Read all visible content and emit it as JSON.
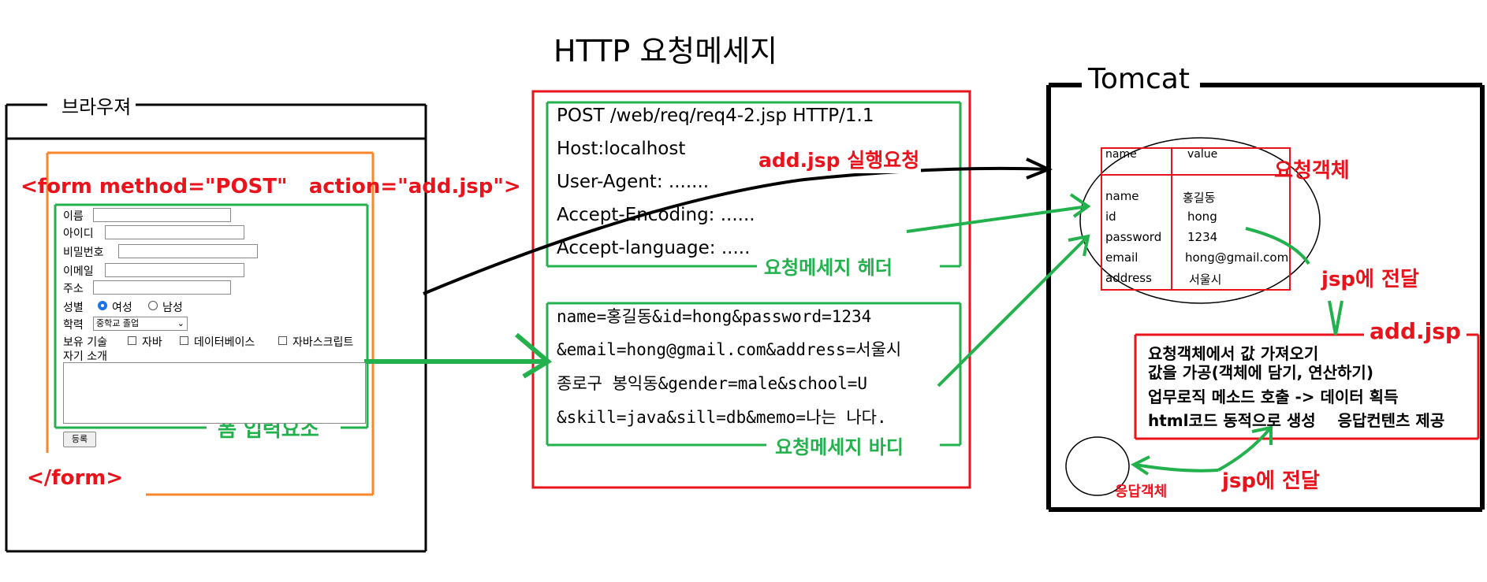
{
  "http": {
    "title": "HTTP 요청메세지",
    "header_lines": [
      "POST /web/req/req4-2.jsp HTTP/1.1",
      "Host:localhost",
      "User-Agent: .......",
      "Accept-Encoding: ......",
      "Accept-language: ....."
    ],
    "header_label": "요청메세지 헤더",
    "body_lines": [
      "name=홍길동&id=hong&password=1234",
      "&email=hong@gmail.com&address=서울시",
      "종로구 봉익동&gender=male&school=U",
      "&skill=java&sill=db&memo=나는 나다."
    ],
    "body_label": "요청메세지 바디"
  },
  "browser": {
    "title": "브라우져",
    "form_open": "<form method=\"POST\"   action=\"add.jsp\">",
    "form_close": "</form>",
    "form_label": "폼 입력요소",
    "fields": {
      "name": "이름",
      "id": "아이디",
      "password": "비밀번호",
      "email": "이메일",
      "address": "주소",
      "gender": "성별",
      "female": "여성",
      "male": "남성",
      "school": "학력",
      "school_selected": "중학교 졸업",
      "skills": "보유 기술",
      "java": "자바",
      "db": "데이터베이스",
      "js": "자바스크립트",
      "intro": "자기 소개",
      "submit": "등록"
    }
  },
  "tomcat": {
    "title": "Tomcat",
    "request_label": "요청객체",
    "table_headers": [
      "name",
      "value"
    ],
    "table_rows": [
      [
        "name",
        "홍길동"
      ],
      [
        "id",
        "hong"
      ],
      [
        "password",
        "1234"
      ],
      [
        "email",
        "hong@gmail.com"
      ],
      [
        "address",
        "서울시"
      ]
    ],
    "pass_label_1": "jsp에 전달",
    "addjsp_label": "add.jsp",
    "addjsp_lines": [
      "요청객체에서 값 가져오기",
      "값을 가공(객체에 담기, 연산하기)",
      "업무로직 메소드 호출 -> 데이터 획득",
      "html코드 동적으로 생성    응답컨텐츠 제공"
    ],
    "pass_label_2": "jsp에 전달",
    "response_label": "응답객체"
  },
  "arrows": {
    "run_request": "add.jsp 실행요청"
  },
  "colors": {
    "red": "#e8131b",
    "green": "#22b14c",
    "orange": "#f7862d",
    "black": "#000000"
  }
}
